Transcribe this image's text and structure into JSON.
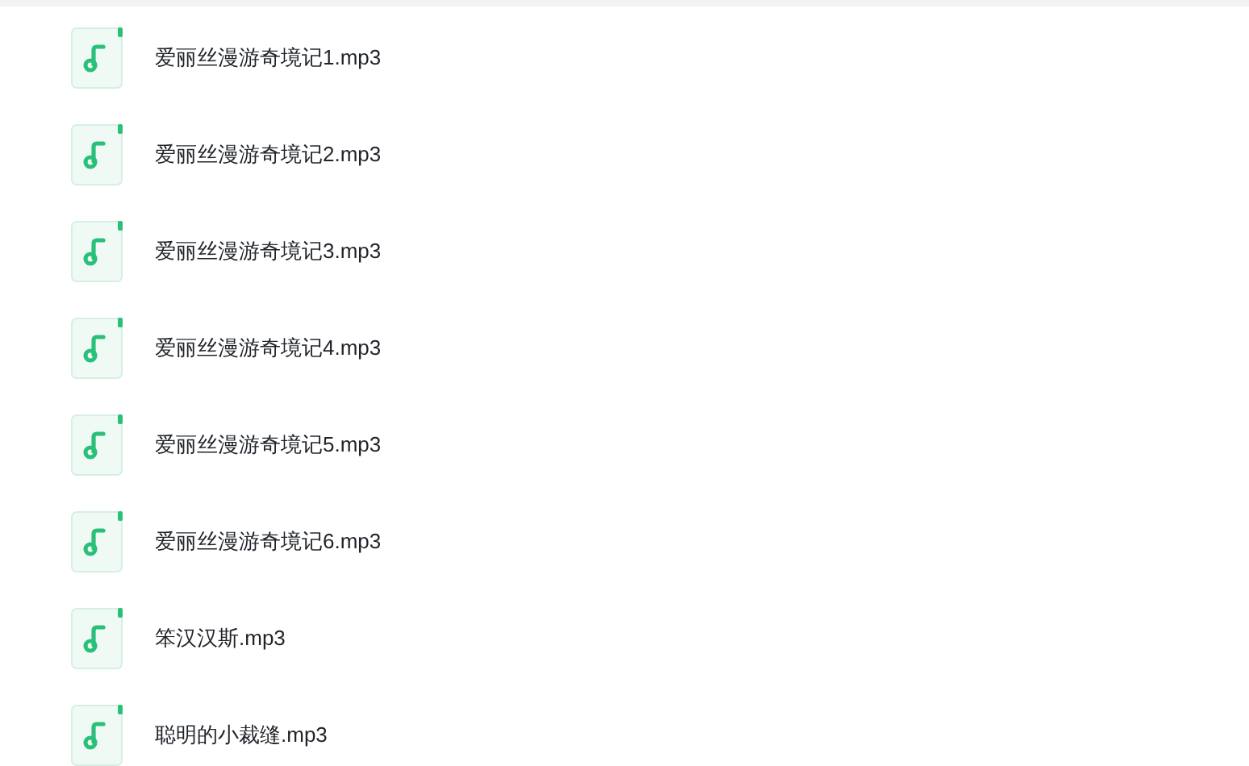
{
  "files": [
    {
      "name": "爱丽丝漫游奇境记1.mp3"
    },
    {
      "name": "爱丽丝漫游奇境记2.mp3"
    },
    {
      "name": "爱丽丝漫游奇境记3.mp3"
    },
    {
      "name": "爱丽丝漫游奇境记4.mp3"
    },
    {
      "name": "爱丽丝漫游奇境记5.mp3"
    },
    {
      "name": "爱丽丝漫游奇境记6.mp3"
    },
    {
      "name": "笨汉汉斯.mp3"
    },
    {
      "name": "聪明的小裁缝.mp3"
    }
  ]
}
